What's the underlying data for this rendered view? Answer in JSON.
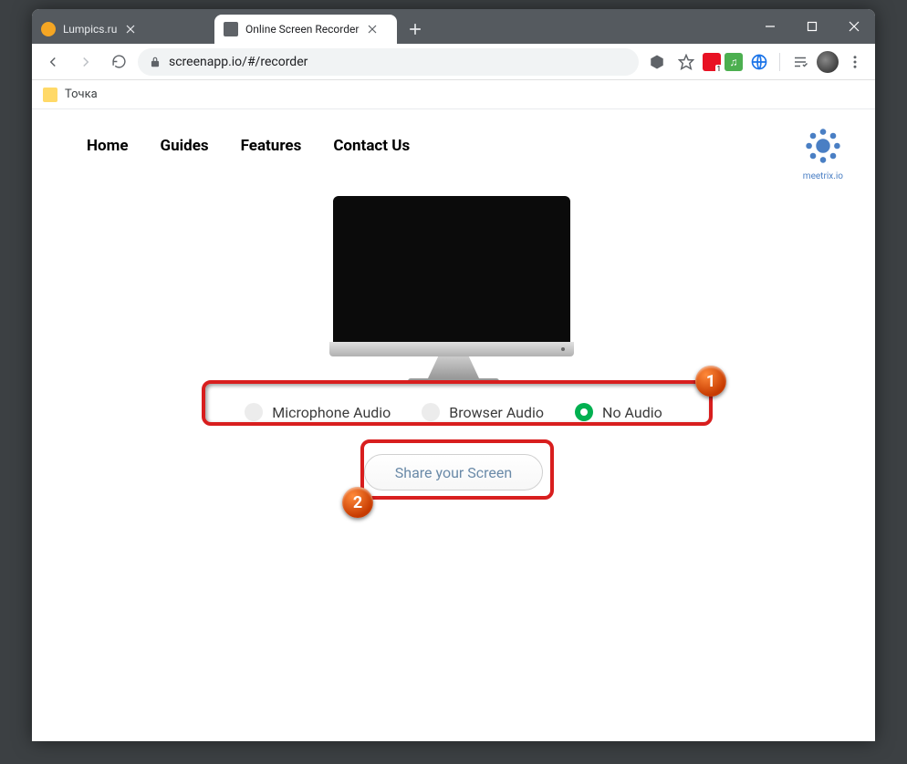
{
  "browser": {
    "tabs": [
      {
        "title": "Lumpics.ru",
        "active": false
      },
      {
        "title": "Online Screen Recorder",
        "active": true
      }
    ],
    "url": "screenapp.io/#/recorder",
    "bookmark": "Точка"
  },
  "nav": {
    "home": "Home",
    "guides": "Guides",
    "features": "Features",
    "contact": "Contact Us"
  },
  "logo_caption": "meetrix.io",
  "audio_options": {
    "mic": "Microphone Audio",
    "browser": "Browser Audio",
    "none": "No Audio",
    "selected": "none"
  },
  "share_button": "Share your Screen",
  "annotations": {
    "step1": "1",
    "step2": "2"
  }
}
